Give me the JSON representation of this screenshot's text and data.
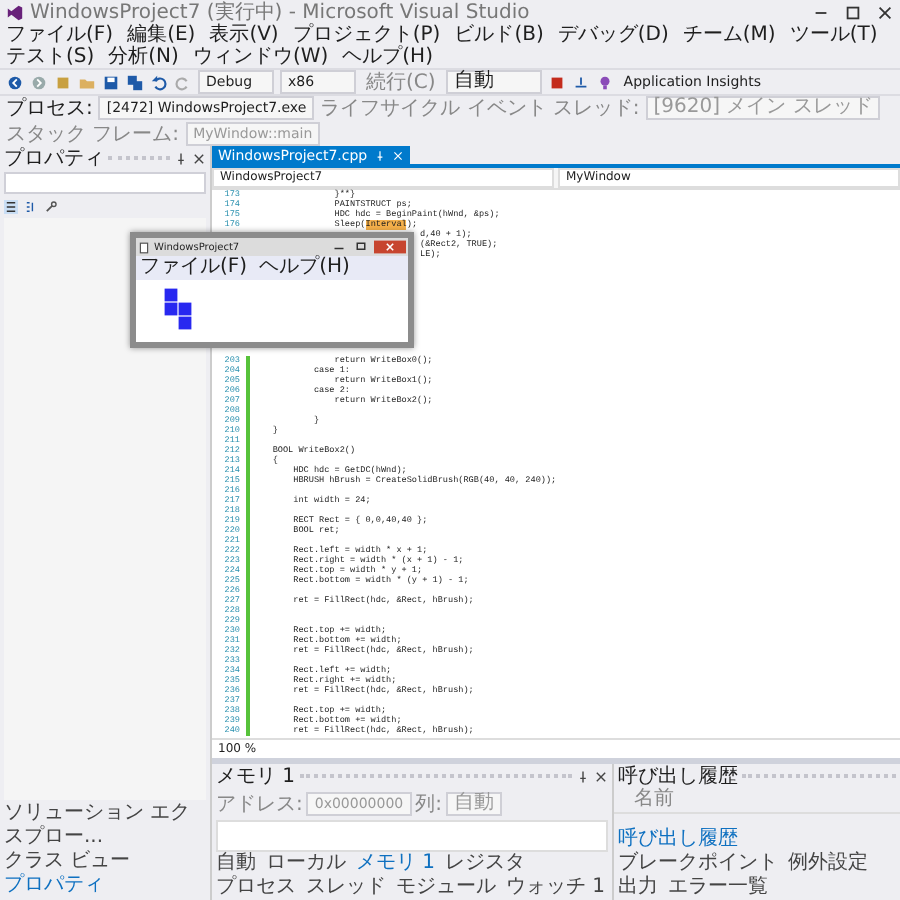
{
  "title": "WindowsProject7 (実行中) - Microsoft Visual Studio",
  "menu": [
    "ファイル(F)",
    "編集(E)",
    "表示(V)",
    "プロジェクト(P)",
    "ビルド(B)",
    "デバッグ(D)",
    "チーム(M)",
    "ツール(T)",
    "テスト(S)",
    "分析(N)",
    "ウィンドウ(W)",
    "ヘルプ(H)"
  ],
  "toolbar": {
    "configuration": "Debug",
    "platform": "x86",
    "continue": "続行(C)",
    "target": "自動",
    "insights": "Application Insights"
  },
  "debug_location": {
    "process_label": "プロセス:",
    "process": "[2472] WindowsProject7.exe",
    "lifecycle": "ライフサイクル イベント",
    "thread_label": "スレッド:",
    "thread": "[9620] メイン スレッド",
    "stack_label": "スタック フレーム:",
    "stack_frame": "MyWindow::main"
  },
  "properties_panel": {
    "title": "プロパティ"
  },
  "left_tabs": [
    {
      "label": "ソリューション エクスプロー...",
      "selected": false
    },
    {
      "label": "クラス ビュー",
      "selected": false
    },
    {
      "label": "プロパティ",
      "selected": true
    }
  ],
  "editor": {
    "tab": "WindowsProject7.cpp",
    "scope": "WindowsProject7",
    "member": "MyWindow",
    "zoom": "100 %",
    "lines_top": [
      {
        "number": "173",
        "text": "                }**}"
      },
      {
        "number": "174",
        "text": "                PAINTSTRUCT ps;"
      },
      {
        "number": "175",
        "text": "                HDC hdc = BeginPaint(hWnd, &ps);"
      },
      {
        "number": "176",
        "text": "                Sleep(",
        "highlight": "Interval",
        "tail": ");"
      }
    ],
    "fragments": [
      "d,40 + 1);",
      "(&Rect2, TRUE);",
      "LE);"
    ],
    "lines_bottom": [
      {
        "number": "203",
        "text": "                return WriteBox0();"
      },
      {
        "number": "204",
        "text": "            case 1:"
      },
      {
        "number": "205",
        "text": "                return WriteBox1();"
      },
      {
        "number": "206",
        "text": "            case 2:"
      },
      {
        "number": "207",
        "text": "                return WriteBox2();"
      },
      {
        "number": "208"
      },
      {
        "number": "209",
        "text": "            }"
      },
      {
        "number": "210",
        "text": "    }"
      },
      {
        "number": "211"
      },
      {
        "number": "212",
        "text": "    BOOL WriteBox2()"
      },
      {
        "number": "213",
        "text": "    {"
      },
      {
        "number": "214",
        "text": "        HDC hdc = GetDC(hWnd);"
      },
      {
        "number": "215",
        "text": "        HBRUSH hBrush = CreateSolidBrush(RGB(40, 40, 240));"
      },
      {
        "number": "216"
      },
      {
        "number": "217",
        "text": "        int width = 24;"
      },
      {
        "number": "218"
      },
      {
        "number": "219",
        "text": "        RECT Rect = { 0,0,40,40 };"
      },
      {
        "number": "220",
        "text": "        BOOL ret;"
      },
      {
        "number": "221"
      },
      {
        "number": "222",
        "text": "        Rect.left = width * x + 1;"
      },
      {
        "number": "223",
        "text": "        Rect.right = width * (x + 1) - 1;"
      },
      {
        "number": "224",
        "text": "        Rect.top = width * y + 1;"
      },
      {
        "number": "225",
        "text": "        Rect.bottom = width * (y + 1) - 1;"
      },
      {
        "number": "226"
      },
      {
        "number": "227",
        "text": "        ret = FillRect(hdc, &Rect, hBrush);"
      },
      {
        "number": "228"
      },
      {
        "number": "229"
      },
      {
        "number": "230",
        "text": "        Rect.top += width;"
      },
      {
        "number": "231",
        "text": "        Rect.bottom += width;"
      },
      {
        "number": "232",
        "text": "        ret = FillRect(hdc, &Rect, hBrush);"
      },
      {
        "number": "233"
      },
      {
        "number": "234",
        "text": "        Rect.left += width;"
      },
      {
        "number": "235",
        "text": "        Rect.right += width;"
      },
      {
        "number": "236",
        "text": "        ret = FillRect(hdc, &Rect, hBrush);"
      },
      {
        "number": "237"
      },
      {
        "number": "238",
        "text": "        Rect.top += width;"
      },
      {
        "number": "239",
        "text": "        Rect.bottom += width;"
      },
      {
        "number": "240",
        "text": "        ret = FillRect(hdc, &Rect, hBrush);"
      }
    ]
  },
  "app_window": {
    "title": "WindowsProject7",
    "menu": [
      "ファイル(F)",
      "ヘルプ(H)"
    ]
  },
  "memory_panel": {
    "title": "メモリ 1",
    "address_label": "アドレス:",
    "address": "0x00000000",
    "columns_label": "列:",
    "columns": "自動",
    "tabs": [
      {
        "label": "自動",
        "selected": false
      },
      {
        "label": "ローカル",
        "selected": false
      },
      {
        "label": "メモリ 1",
        "selected": true
      },
      {
        "label": "レジスタ",
        "selected": false
      },
      {
        "label": "プロセス",
        "selected": false
      },
      {
        "label": "スレッド",
        "selected": false
      },
      {
        "label": "モジュール",
        "selected": false
      },
      {
        "label": "ウォッチ 1",
        "selected": false
      }
    ]
  },
  "call_stack_panel": {
    "title": "呼び出し履歴",
    "column": "名前",
    "tabs": [
      {
        "label": "呼び出し履歴",
        "selected": true
      },
      {
        "label": "ブレークポイント",
        "selected": false
      },
      {
        "label": "例外設定",
        "selected": false
      },
      {
        "label": "出力",
        "selected": false
      },
      {
        "label": "エラー一覧",
        "selected": false
      }
    ]
  }
}
